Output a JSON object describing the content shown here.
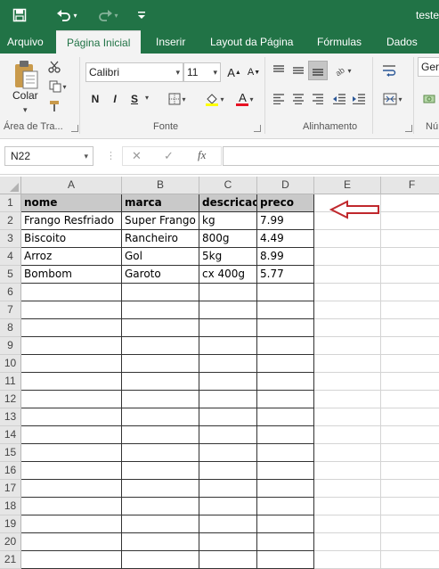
{
  "app": {
    "title": "teste"
  },
  "qat": {
    "save_icon": "save-icon",
    "undo_icon": "undo-icon",
    "redo_icon": "redo-icon",
    "customize_icon": "customize-icon"
  },
  "tabs": [
    "Arquivo",
    "Página Inicial",
    "Inserir",
    "Layout da Página",
    "Fórmulas",
    "Dados"
  ],
  "ribbon": {
    "clipboard": {
      "paste_label": "Colar",
      "group_label": "Área de Tra..."
    },
    "font": {
      "name": "Calibri",
      "size": "11",
      "bold": "N",
      "italic": "I",
      "underline": "S",
      "color_letter": "A",
      "group_label": "Fonte"
    },
    "alignment": {
      "group_label": "Alinhamento"
    },
    "number": {
      "format": "Gera",
      "group_label": "Nú"
    }
  },
  "formula_bar": {
    "name_box": "N22",
    "fx": "fx",
    "value": ""
  },
  "columns": [
    "A",
    "B",
    "C",
    "D",
    "E",
    "F"
  ],
  "rows": [
    [
      "nome",
      "marca",
      "descricao",
      "preco"
    ],
    [
      "Frango Resfriado",
      "Super Frango",
      "kg",
      "7.99"
    ],
    [
      "Biscoito",
      "Rancheiro",
      "800g",
      "4.49"
    ],
    [
      "Arroz",
      "Gol",
      "5kg",
      "8.99"
    ],
    [
      "Bombom",
      "Garoto",
      "cx 400g",
      "5.77"
    ]
  ],
  "row_numbers": [
    "1",
    "2",
    "3",
    "4",
    "5",
    "6",
    "7",
    "8",
    "9",
    "10",
    "11",
    "12",
    "13",
    "14",
    "15",
    "16",
    "17",
    "18",
    "19",
    "20",
    "21"
  ],
  "colors": {
    "excel_green": "#217346",
    "header_fill": "#c9c9c9",
    "annotation_arrow": "#c0282d"
  }
}
